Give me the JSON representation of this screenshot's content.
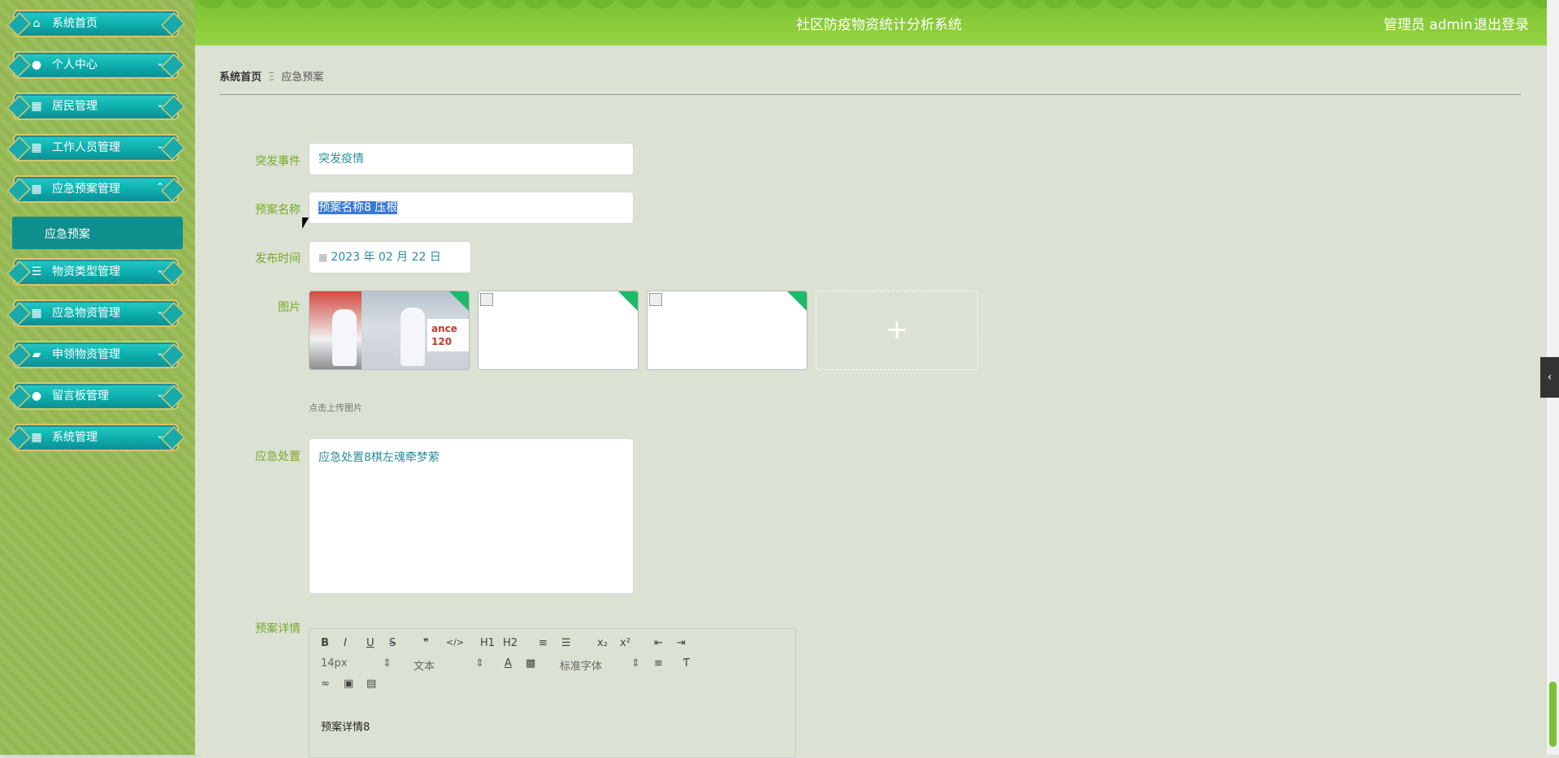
{
  "app": {
    "title": "社区防疫物资统计分析系统",
    "user_label": "管理员 admin",
    "logout_label": "退出登录"
  },
  "sidebar": {
    "items": [
      {
        "label": "系统首页",
        "icon": "home-icon"
      },
      {
        "label": "个人中心",
        "icon": "user-icon"
      },
      {
        "label": "居民管理",
        "icon": "grid-icon"
      },
      {
        "label": "工作人员管理",
        "icon": "grid-icon"
      },
      {
        "label": "应急预案管理",
        "icon": "grid-icon"
      },
      {
        "label": "物资类型管理",
        "icon": "sliders-icon"
      },
      {
        "label": "应急物资管理",
        "icon": "grid-icon"
      },
      {
        "label": "申领物资管理",
        "icon": "briefcase-icon"
      },
      {
        "label": "留言板管理",
        "icon": "bulb-icon"
      },
      {
        "label": "系统管理",
        "icon": "grid-icon"
      }
    ],
    "sub_item": {
      "label": "应急预案"
    }
  },
  "breadcrumb": {
    "home": "系统首页",
    "separator": "Ξ",
    "current": "应急预案"
  },
  "form": {
    "event_label": "突发事件",
    "event_value": "突发疫情",
    "name_label": "预案名称",
    "name_value": "预案名称8 压根",
    "date_label": "发布时间",
    "date_value": "2023 年 02 月 22 日",
    "image_label": "图片",
    "image_text": "ance 120",
    "upload_plus": "+",
    "upload_hint": "点击上传图片",
    "handling_label": "应急处置",
    "handling_value": "应急处置8棋左魂牵梦萦",
    "detail_label": "预案详情"
  },
  "editor": {
    "toolbar_row1": [
      "B",
      "I",
      "U",
      "S",
      "❞",
      "</>",
      "H1",
      "H2",
      "≡",
      "☰",
      "x₂",
      "x²",
      "⇤",
      "⇥"
    ],
    "font_size": "14px",
    "text_type": "文本",
    "font_family": "标准字体",
    "content": "预案详情8"
  },
  "colors": {
    "accent": "#79c236",
    "nav": "#0fb3b0",
    "label": "#79a92b"
  }
}
